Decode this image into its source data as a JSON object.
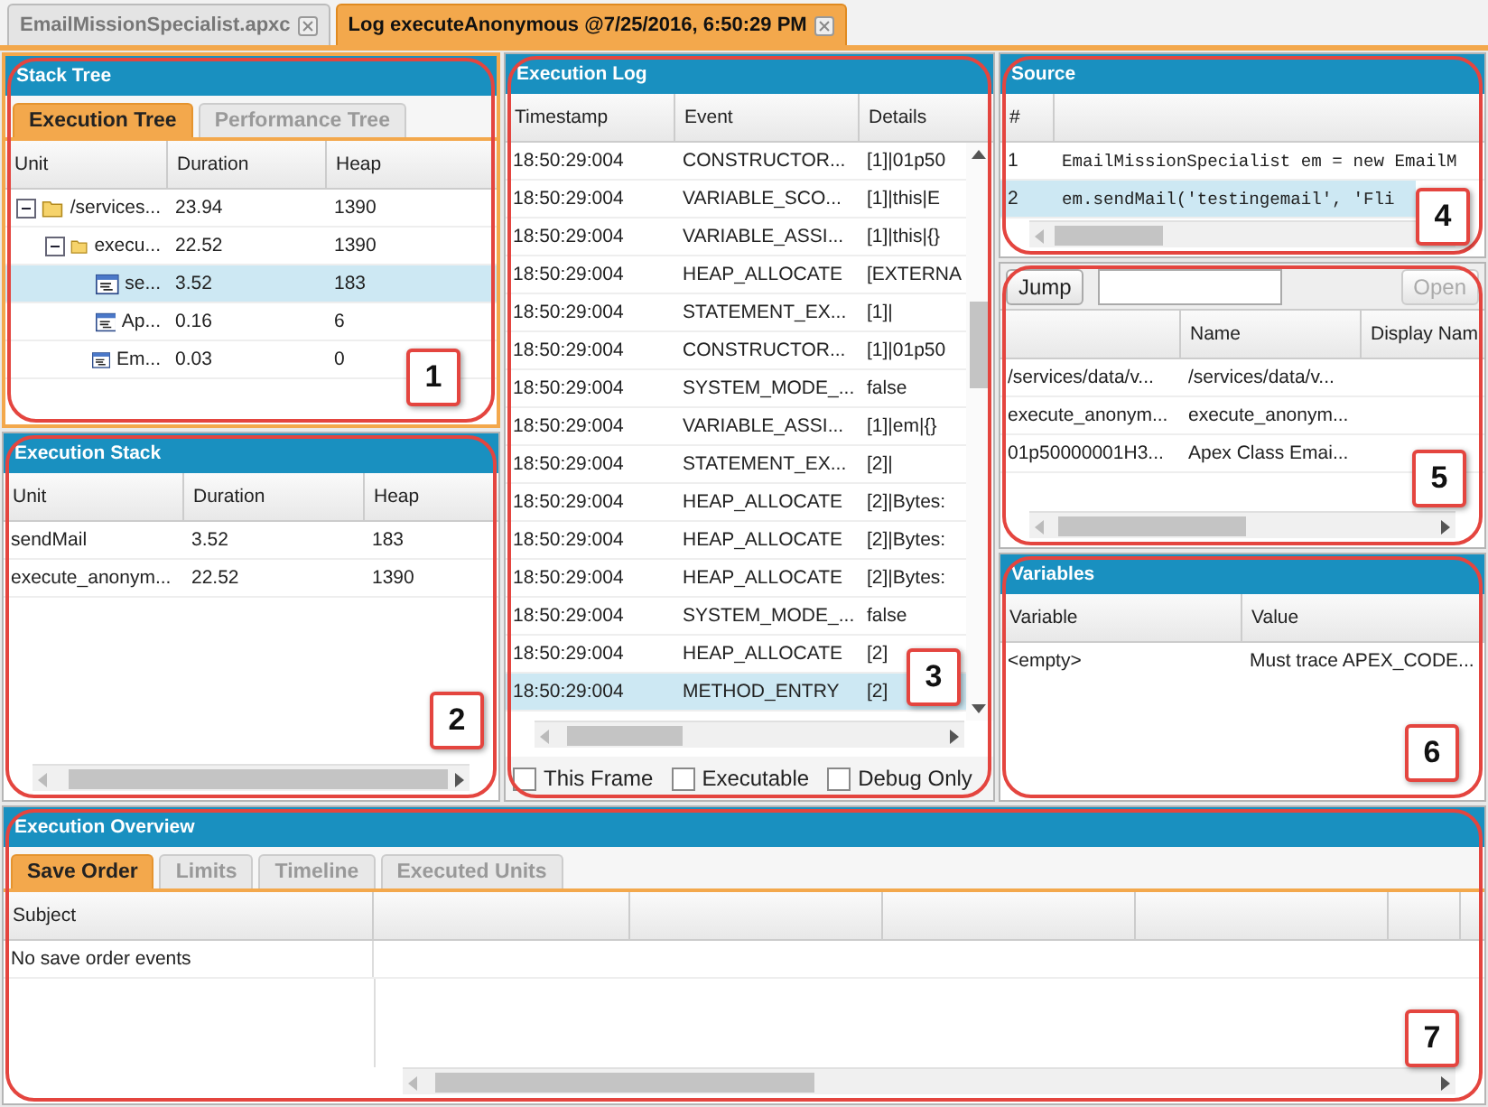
{
  "editor_tabs": [
    {
      "label": "EmailMissionSpecialist.apxc",
      "selected": false
    },
    {
      "label": "Log executeAnonymous @7/25/2016, 6:50:29 PM",
      "selected": true
    }
  ],
  "stack_tree": {
    "title": "Stack Tree",
    "focused": true,
    "callout": "1",
    "tabs": [
      {
        "label": "Execution Tree",
        "selected": true
      },
      {
        "label": "Performance Tree",
        "selected": false
      }
    ],
    "columns": [
      "Unit",
      "Duration",
      "Heap"
    ],
    "rows": [
      {
        "kind": "folder",
        "unit": "/services...",
        "duration": "23.94",
        "heap": "1390",
        "selected": false,
        "expanded": true,
        "children": [
          {
            "kind": "folder",
            "unit": "execu...",
            "duration": "22.52",
            "heap": "1390",
            "selected": false,
            "expanded": true,
            "children": [
              {
                "kind": "method",
                "unit": "se...",
                "duration": "3.52",
                "heap": "183",
                "selected": true
              },
              {
                "kind": "method",
                "unit": "Ap...",
                "duration": "0.16",
                "heap": "6",
                "selected": false
              },
              {
                "kind": "method",
                "unit": "Em...",
                "duration": "0.03",
                "heap": "0",
                "selected": false
              }
            ]
          }
        ]
      }
    ]
  },
  "execution_stack": {
    "title": "Execution Stack",
    "focused": false,
    "callout": "2",
    "columns": [
      "Unit",
      "Duration",
      "Heap"
    ],
    "rows": [
      [
        "sendMail",
        "3.52",
        "183"
      ],
      [
        "execute_anonym...",
        "22.52",
        "1390"
      ]
    ]
  },
  "execution_log": {
    "title": "Execution Log",
    "focused": false,
    "callout": "3",
    "columns": [
      "Timestamp",
      "Event",
      "Details"
    ],
    "rows": [
      {
        "timestamp": "18:50:29:004",
        "event": "CONSTRUCTOR...",
        "details": "[1]|01p50",
        "selected": false
      },
      {
        "timestamp": "18:50:29:004",
        "event": "VARIABLE_SCO...",
        "details": "[1]|this|E",
        "selected": false
      },
      {
        "timestamp": "18:50:29:004",
        "event": "VARIABLE_ASSI...",
        "details": "[1]|this|{}",
        "selected": false
      },
      {
        "timestamp": "18:50:29:004",
        "event": "HEAP_ALLOCATE",
        "details": "[EXTERNA",
        "selected": false
      },
      {
        "timestamp": "18:50:29:004",
        "event": "STATEMENT_EX...",
        "details": "[1]|",
        "selected": false
      },
      {
        "timestamp": "18:50:29:004",
        "event": "CONSTRUCTOR...",
        "details": "[1]|01p50",
        "selected": false
      },
      {
        "timestamp": "18:50:29:004",
        "event": "SYSTEM_MODE_...",
        "details": "false",
        "selected": false
      },
      {
        "timestamp": "18:50:29:004",
        "event": "VARIABLE_ASSI...",
        "details": "[1]|em|{}",
        "selected": false
      },
      {
        "timestamp": "18:50:29:004",
        "event": "STATEMENT_EX...",
        "details": "[2]|",
        "selected": false
      },
      {
        "timestamp": "18:50:29:004",
        "event": "HEAP_ALLOCATE",
        "details": "[2]|Bytes:",
        "selected": false
      },
      {
        "timestamp": "18:50:29:004",
        "event": "HEAP_ALLOCATE",
        "details": "[2]|Bytes:",
        "selected": false
      },
      {
        "timestamp": "18:50:29:004",
        "event": "HEAP_ALLOCATE",
        "details": "[2]|Bytes:",
        "selected": false
      },
      {
        "timestamp": "18:50:29:004",
        "event": "SYSTEM_MODE_...",
        "details": "false",
        "selected": false
      },
      {
        "timestamp": "18:50:29:004",
        "event": "HEAP_ALLOCATE",
        "details": "[2]",
        "selected": false
      },
      {
        "timestamp": "18:50:29:004",
        "event": "METHOD_ENTRY",
        "details": "[2]",
        "selected": true
      }
    ],
    "filters": [
      {
        "label": "This Frame",
        "checked": false
      },
      {
        "label": "Executable",
        "checked": false
      },
      {
        "label": "Debug Only",
        "checked": false
      }
    ]
  },
  "source": {
    "title": "Source",
    "focused": false,
    "callout": "4",
    "columns": [
      "#"
    ],
    "lines": [
      {
        "number": "1",
        "code": "EmailMissionSpecialist em = new EmailM",
        "selected": false
      },
      {
        "number": "2",
        "code": "em.sendMail('testingemail', 'Fli",
        "selected": true
      }
    ]
  },
  "units": {
    "callout": "5",
    "jump_button": "Jump",
    "open_button": {
      "label": "Open",
      "disabled": true
    },
    "columns": [
      "",
      "Name",
      "Display Nam"
    ],
    "rows": [
      [
        "/services/data/v...",
        "/services/data/v..."
      ],
      [
        "execute_anonym...",
        "execute_anonym..."
      ],
      [
        "01p50000001H3...",
        "Apex Class Emai..."
      ]
    ]
  },
  "variables": {
    "title": "Variables",
    "focused": false,
    "callout": "6",
    "columns": [
      "Variable",
      "Value"
    ],
    "rows": [
      [
        "<empty>",
        "Must trace APEX_CODE..."
      ]
    ]
  },
  "execution_overview": {
    "title": "Execution Overview",
    "focused": false,
    "callout": "7",
    "tabs": [
      {
        "label": "Save Order",
        "selected": true
      },
      {
        "label": "Limits",
        "selected": false
      },
      {
        "label": "Timeline",
        "selected": false
      },
      {
        "label": "Executed Units",
        "selected": false
      }
    ],
    "columns": [
      "Subject"
    ],
    "rows": [
      "No save order events"
    ]
  }
}
